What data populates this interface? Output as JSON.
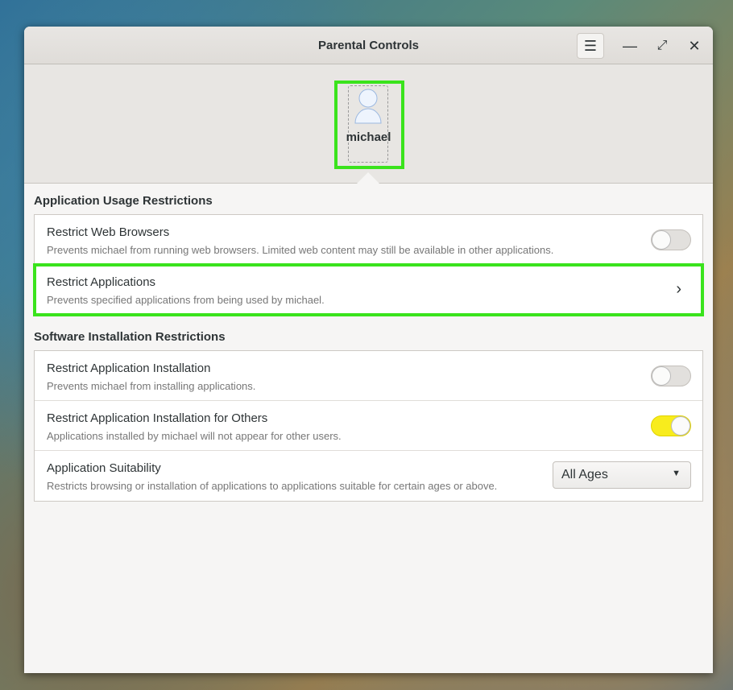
{
  "window": {
    "title": "Parental Controls"
  },
  "user": {
    "name": "michael"
  },
  "sections": [
    {
      "title": "Application Usage Restrictions",
      "rows": [
        {
          "title": "Restrict Web Browsers",
          "subtitle": "Prevents michael from running web browsers. Limited web content may still be available in other applications.",
          "toggle": false
        },
        {
          "title": "Restrict Applications",
          "subtitle": "Prevents specified applications from being used by michael."
        }
      ]
    },
    {
      "title": "Software Installation Restrictions",
      "rows": [
        {
          "title": "Restrict Application Installation",
          "subtitle": "Prevents michael from installing applications.",
          "toggle": false
        },
        {
          "title": "Restrict Application Installation for Others",
          "subtitle": "Applications installed by michael will not appear for other users.",
          "toggle": true
        },
        {
          "title": "Application Suitability",
          "subtitle": "Restricts browsing or installation of applications to applications suitable for certain ages or above.",
          "value": "All Ages"
        }
      ]
    }
  ],
  "colors": {
    "highlight": "#3ae31c",
    "toggle_on": "#f8ec1d"
  }
}
